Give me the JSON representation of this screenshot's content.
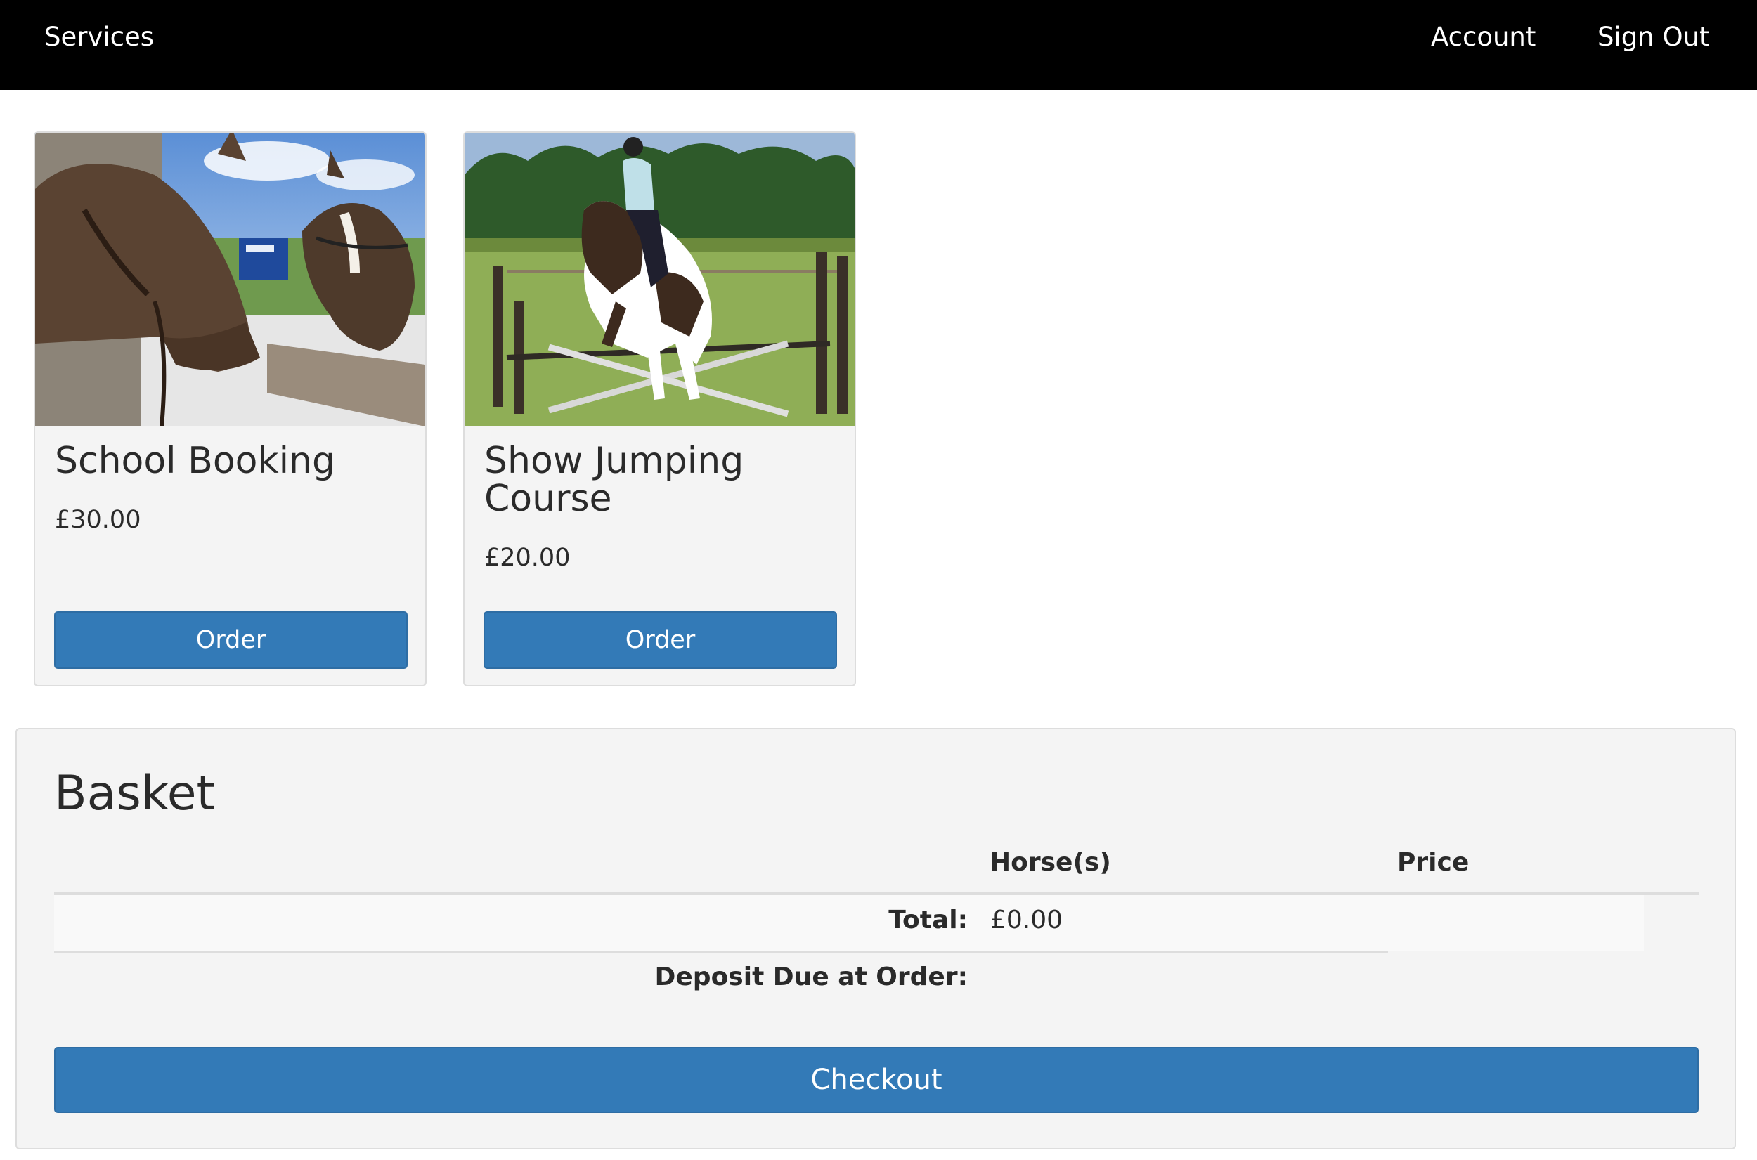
{
  "nav": {
    "services_label": "Services",
    "account_label": "Account",
    "signout_label": "Sign Out"
  },
  "services": [
    {
      "title": "School Booking",
      "price": "£30.00",
      "order_label": "Order",
      "image": "two-horses-photo"
    },
    {
      "title": "Show Jumping Course",
      "price": "£20.00",
      "order_label": "Order",
      "image": "show-jumping-photo"
    }
  ],
  "basket": {
    "title": "Basket",
    "columns": [
      "Horse(s)",
      "Price"
    ],
    "total_label": "Total:",
    "total_value": "£0.00",
    "deposit_label": "Deposit Due at Order:",
    "checkout_label": "Checkout"
  },
  "colors": {
    "nav_bg": "#000000",
    "primary_button": "#337ab7",
    "panel_bg": "#f4f4f4"
  }
}
